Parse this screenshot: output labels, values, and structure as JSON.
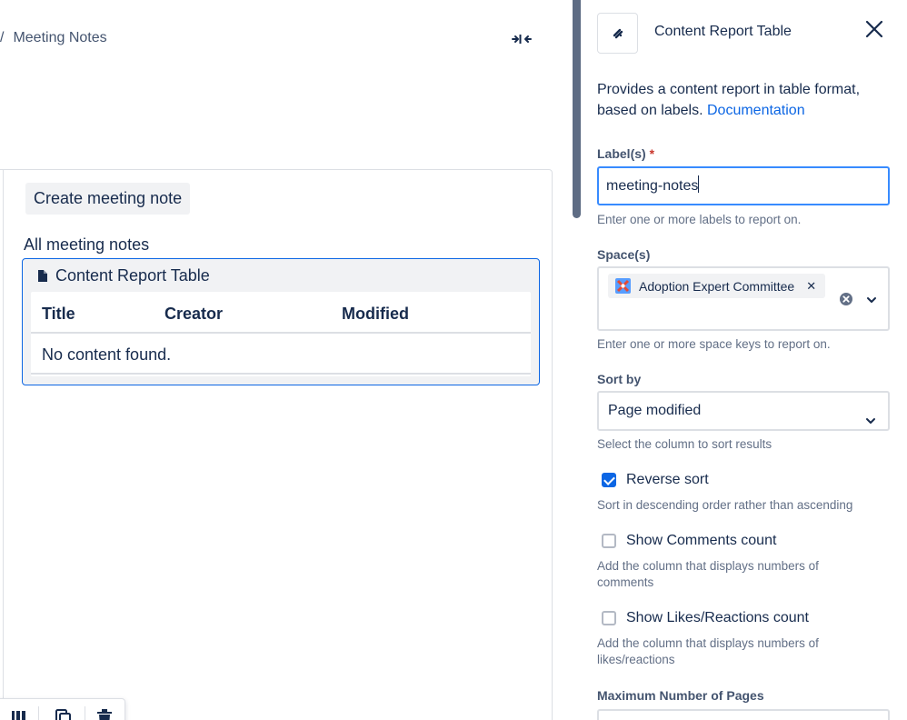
{
  "breadcrumb": {
    "separator": "/",
    "current": "Meeting Notes"
  },
  "editor": {
    "create_button": "Create meeting note",
    "section_heading": "All meeting notes",
    "macro": {
      "title": "Content Report Table",
      "columns": [
        "Title",
        "Creator",
        "Modified"
      ],
      "empty_message": "No content found."
    }
  },
  "panel": {
    "title": "Content Report Table",
    "description": "Provides a content report in table format, based on labels.",
    "doc_link": "Documentation",
    "labels": {
      "label": "Label(s)",
      "required_mark": "*",
      "value": "meeting-notes",
      "help": "Enter one or more labels to report on."
    },
    "spaces": {
      "label": "Space(s)",
      "selected": [
        "Adoption Expert Committee"
      ],
      "help": "Enter one or more space keys to report on."
    },
    "sort_by": {
      "label": "Sort by",
      "value": "Page modified",
      "help": "Select the column to sort results"
    },
    "reverse_sort": {
      "label": "Reverse sort",
      "checked": true,
      "help": "Sort in descending order rather than ascending"
    },
    "show_comments": {
      "label": "Show Comments count",
      "checked": false,
      "help": "Add the column that displays numbers of comments"
    },
    "show_likes": {
      "label": "Show Likes/Reactions count",
      "checked": false,
      "help": "Add the column that displays numbers of likes/reactions"
    },
    "max_pages": {
      "label": "Maximum Number of Pages"
    }
  },
  "icons": {
    "collapse": "collapse-arrows-icon",
    "close": "close-icon",
    "page": "page-icon",
    "macro": "macro-icon",
    "space_avatar": "space-avatar-icon",
    "clear": "clear-icon",
    "chevron": "chevron-down-icon"
  },
  "colors": {
    "accent": "#0C66E4",
    "focus_border": "#388BFF",
    "text": "#172B4D",
    "subtle_text": "#626F86",
    "required": "#C9372C"
  }
}
